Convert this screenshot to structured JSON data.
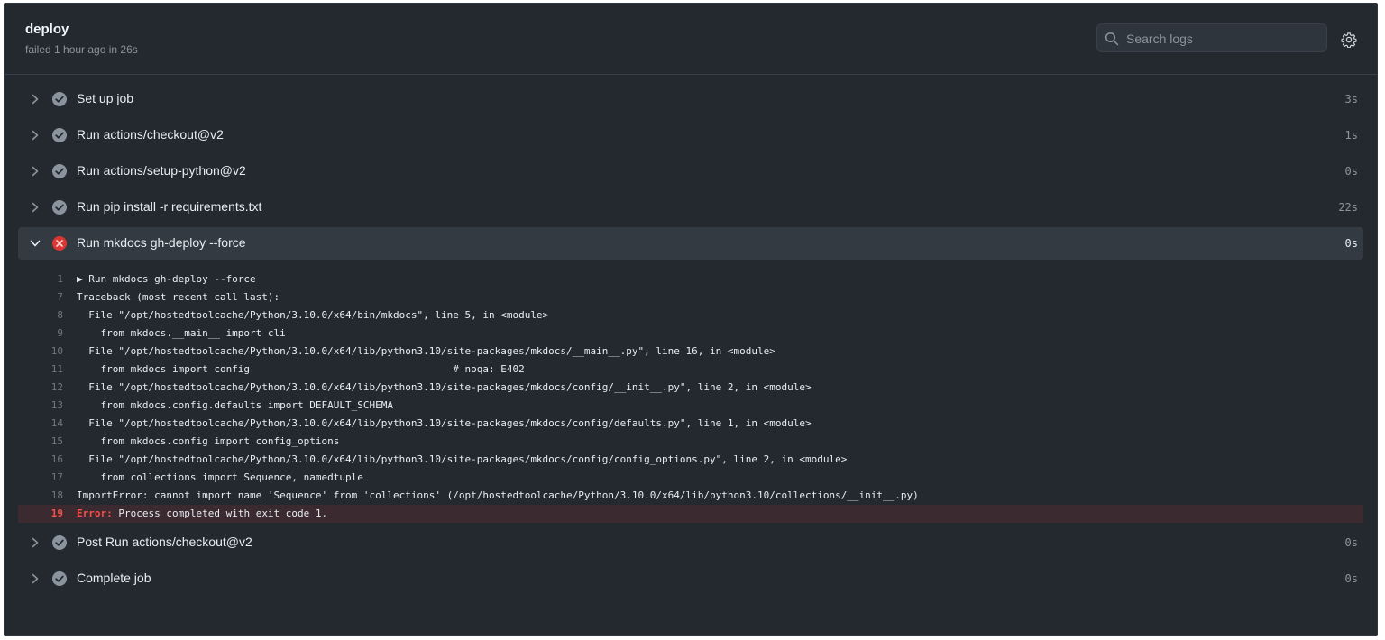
{
  "job": {
    "title": "deploy",
    "subtitle": "failed 1 hour ago in 26s"
  },
  "search": {
    "placeholder": "Search logs"
  },
  "icons": {
    "search": "search-icon",
    "settings": "gear-icon",
    "success": "check-circle-icon",
    "failure": "x-circle-icon",
    "collapsed": "chevron-right-icon",
    "expanded": "chevron-down-icon"
  },
  "colors": {
    "background": "#24292f",
    "error": "#f85149",
    "success_icon": "#8b949e"
  },
  "steps_before": [
    {
      "label": "Set up job",
      "duration": "3s"
    },
    {
      "label": "Run actions/checkout@v2",
      "duration": "1s"
    },
    {
      "label": "Run actions/setup-python@v2",
      "duration": "0s"
    },
    {
      "label": "Run pip install -r requirements.txt",
      "duration": "22s"
    }
  ],
  "failed_step": {
    "label": "Run mkdocs gh-deploy --force",
    "duration": "0s"
  },
  "log": [
    {
      "n": "1",
      "text": "Run mkdocs gh-deploy --force",
      "group": true
    },
    {
      "n": "7",
      "text": "Traceback (most recent call last):"
    },
    {
      "n": "8",
      "text": "  File \"/opt/hostedtoolcache/Python/3.10.0/x64/bin/mkdocs\", line 5, in <module>"
    },
    {
      "n": "9",
      "text": "    from mkdocs.__main__ import cli"
    },
    {
      "n": "10",
      "text": "  File \"/opt/hostedtoolcache/Python/3.10.0/x64/lib/python3.10/site-packages/mkdocs/__main__.py\", line 16, in <module>"
    },
    {
      "n": "11",
      "text": "    from mkdocs import config                                  # noqa: E402"
    },
    {
      "n": "12",
      "text": "  File \"/opt/hostedtoolcache/Python/3.10.0/x64/lib/python3.10/site-packages/mkdocs/config/__init__.py\", line 2, in <module>"
    },
    {
      "n": "13",
      "text": "    from mkdocs.config.defaults import DEFAULT_SCHEMA"
    },
    {
      "n": "14",
      "text": "  File \"/opt/hostedtoolcache/Python/3.10.0/x64/lib/python3.10/site-packages/mkdocs/config/defaults.py\", line 1, in <module>"
    },
    {
      "n": "15",
      "text": "    from mkdocs.config import config_options"
    },
    {
      "n": "16",
      "text": "  File \"/opt/hostedtoolcache/Python/3.10.0/x64/lib/python3.10/site-packages/mkdocs/config/config_options.py\", line 2, in <module>"
    },
    {
      "n": "17",
      "text": "    from collections import Sequence, namedtuple"
    },
    {
      "n": "18",
      "text": "ImportError: cannot import name 'Sequence' from 'collections' (/opt/hostedtoolcache/Python/3.10.0/x64/lib/python3.10/collections/__init__.py)"
    },
    {
      "n": "19",
      "error_tag": "Error:",
      "text": " Process completed with exit code 1.",
      "error": true
    }
  ],
  "steps_after": [
    {
      "label": "Post Run actions/checkout@v2",
      "duration": "0s"
    },
    {
      "label": "Complete job",
      "duration": "0s"
    }
  ]
}
